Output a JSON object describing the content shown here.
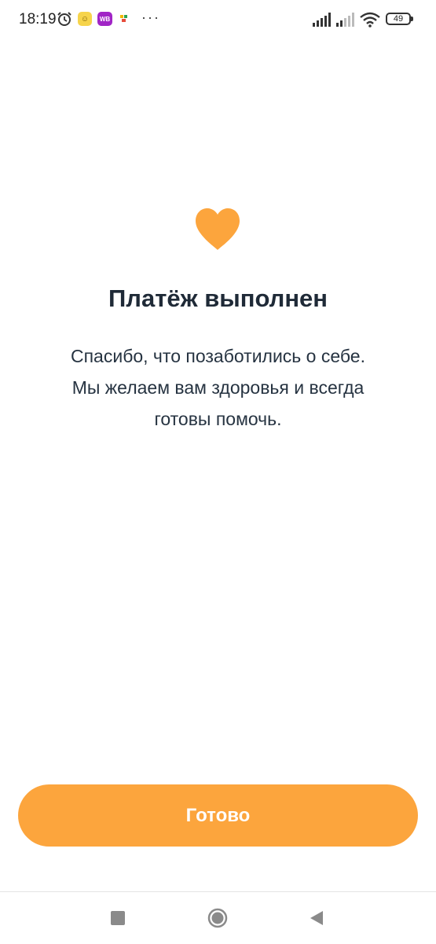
{
  "status_bar": {
    "time": "18:19",
    "wb_label": "WB",
    "more_indicator": "···",
    "battery_level": "49",
    "icons": [
      "alarm-icon",
      "notification-app-icon",
      "wildberries-app-icon",
      "notification-dot-icon",
      "signal-icon",
      "signal-icon",
      "wifi-icon",
      "battery-icon"
    ]
  },
  "main": {
    "icon": "heart-icon",
    "icon_color": "#FCA53D",
    "title": "Платёж выполнен",
    "message_lines": [
      "Спасибо, что позаботились о себе.",
      "Мы желаем вам здоровья и всегда",
      "готовы помочь."
    ]
  },
  "actions": {
    "done_label": "Готово",
    "button_color": "#FCA53D"
  },
  "nav_bar": {
    "icons": [
      "recent-apps-icon",
      "home-icon",
      "back-icon"
    ]
  }
}
